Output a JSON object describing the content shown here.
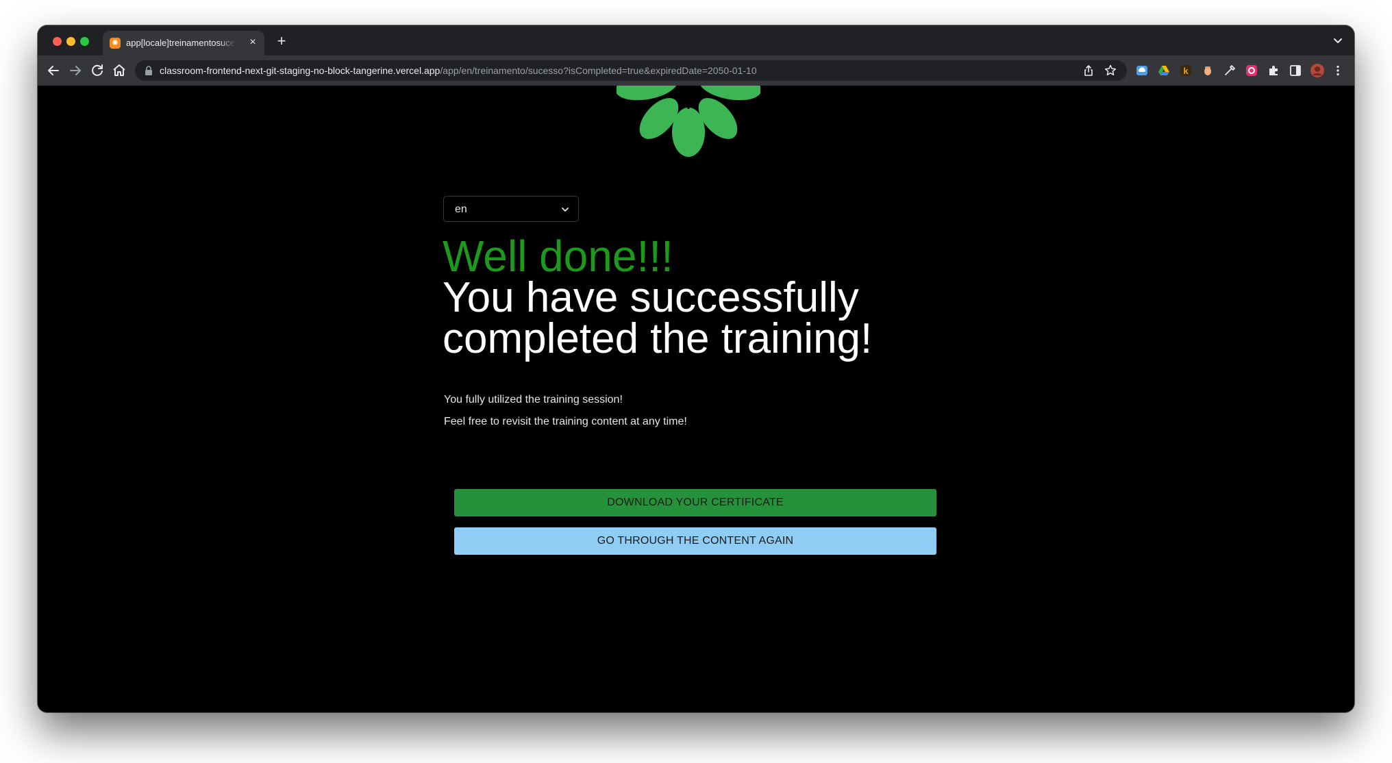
{
  "browser": {
    "tab_title": "app[locale]treinamentosucesso",
    "url_host": "classroom-frontend-next-git-staging-no-block-tangerine.vercel.app",
    "url_path": "/app/en/treinamento/sucesso?isCompleted=true&expiredDate=2050-01-10",
    "new_tab_symbol": "+",
    "close_symbol": "×"
  },
  "page": {
    "language_selected": "en",
    "headline_green": "Well done!!!",
    "headline_white": "You have successfully completed the training!",
    "line1": "You fully utilized the training session!",
    "line2": "Feel free to revisit the training content at any time!",
    "download_button": "DOWNLOAD YOUR CERTIFICATE",
    "again_button": "GO THROUGH THE CONTENT AGAIN"
  },
  "colors": {
    "accent_green": "#1b9a1b",
    "logo_green": "#3cb554",
    "download_bg": "#25913a",
    "again_bg": "#90cdf4"
  },
  "icons": [
    "back-arrow-icon",
    "forward-arrow-icon",
    "reload-icon",
    "home-icon",
    "lock-icon",
    "share-icon",
    "star-icon",
    "extension-icons",
    "puzzle-icon",
    "side-panel-icon",
    "profile-avatar",
    "menu-kebab-icon",
    "chevron-down-icon",
    "flower-logo"
  ]
}
